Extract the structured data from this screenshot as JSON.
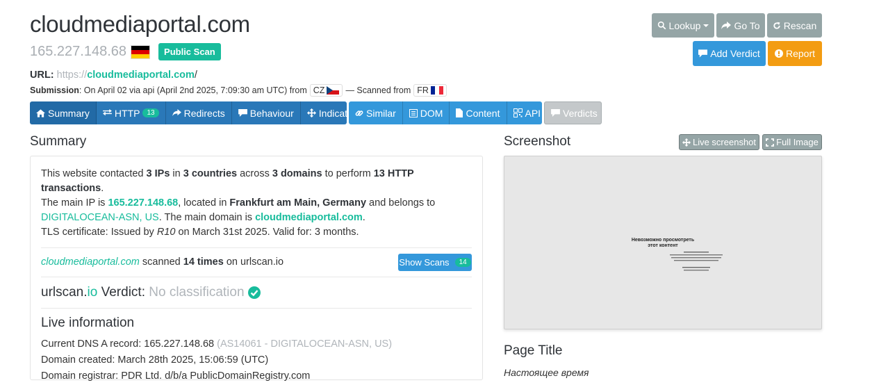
{
  "header": {
    "domain": "cloudmediaportal.com",
    "ip": "165.227.148.68",
    "scan_badge": "Public Scan"
  },
  "actions": {
    "lookup": "Lookup",
    "goto": "Go To",
    "rescan": "Rescan",
    "add_verdict": "Add Verdict",
    "report": "Report"
  },
  "url": {
    "label": "URL:",
    "protocol": "https://",
    "domain": "cloudmediaportal.com",
    "path": "/"
  },
  "submission": {
    "label": "Submission",
    "text": ": On April 02 via api (April 2nd 2025, 7:09:30 am UTC) from",
    "from_country": "CZ",
    "scanned_from_text": "— Scanned from",
    "scanned_country": "FR"
  },
  "tabs": {
    "summary": "Summary",
    "http": "HTTP",
    "http_count": "13",
    "redirects": "Redirects",
    "behaviour": "Behaviour",
    "indicators": "Indicators",
    "similar": "Similar",
    "dom": "DOM",
    "content": "Content",
    "api": "API",
    "verdicts": "Verdicts"
  },
  "summary": {
    "title": "Summary",
    "l1_a": "This website contacted ",
    "l1_ips": "3 IPs",
    "l1_b": " in ",
    "l1_countries": "3 countries",
    "l1_c": " across ",
    "l1_domains": "3 domains",
    "l1_d": " to perform ",
    "l1_tx": "13 HTTP transactions",
    "l1_e": ".",
    "l2_a": "The main IP is ",
    "l2_ip": "165.227.148.68",
    "l2_b": ", located in ",
    "l2_loc": "Frankfurt am Main, Germany",
    "l2_c": " and belongs to",
    "l3_asn": "DIGITALOCEAN-ASN, US",
    "l3_a": ". The main domain is ",
    "l3_domain": "cloudmediaportal.com",
    "l3_b": ".",
    "l4_a": "TLS certificate: Issued by ",
    "l4_issuer": "R10",
    "l4_b": " on March 31st 2025. Valid for: 3 months.",
    "scanned_domain": "cloudmediaportal.com",
    "scanned_a": " scanned ",
    "scanned_times": "14 times",
    "scanned_b": " on urlscan.io",
    "show_scans": "Show Scans",
    "show_scans_count": "14",
    "verdict_a": "urlscan.",
    "verdict_io": "io",
    "verdict_b": " Verdict: ",
    "verdict_value": "No classification"
  },
  "live": {
    "title": "Live information",
    "dns_label": "Current DNS A record: 165.227.148.68",
    "dns_asn": "(AS14061 - DIGITALOCEAN-ASN, US)",
    "created": "Domain created: March 28th 2025, 15:06:59 (UTC)",
    "registrar": "Domain registrar: PDR Ltd. d/b/a PublicDomainRegistry.com"
  },
  "screenshot": {
    "title": "Screenshot",
    "live_button": "Live screenshot",
    "full_button": "Full Image",
    "heading_1": "Невозможно просмотреть",
    "heading_2": "этот контент"
  },
  "page_title": {
    "title": "Page Title",
    "value": "Настоящее время"
  },
  "colors": {
    "green": "#18bc9c",
    "blue": "#3498db",
    "gray": "#95a5a6",
    "orange": "#f39c12"
  }
}
